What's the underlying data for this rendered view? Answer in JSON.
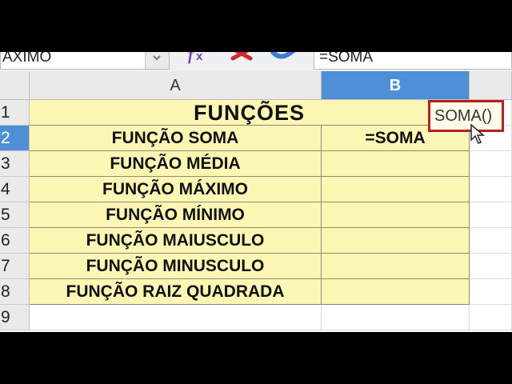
{
  "toolbar": {
    "name_box_value": "AXIMO",
    "formula_value": "=SOMA",
    "icons": [
      "function-wizard-icon",
      "cancel-icon",
      "accept-icon"
    ]
  },
  "columns": [
    "A",
    "B"
  ],
  "rows": [
    {
      "num": "1",
      "a": "FUNÇÕES",
      "b": ""
    },
    {
      "num": "2",
      "a": "FUNÇÃO SOMA",
      "b": "=SOMA"
    },
    {
      "num": "3",
      "a": "FUNÇÃO MÉDIA",
      "b": ""
    },
    {
      "num": "4",
      "a": "FUNÇÃO MÁXIMO",
      "b": ""
    },
    {
      "num": "5",
      "a": "FUNÇÃO MÍNIMO",
      "b": ""
    },
    {
      "num": "6",
      "a": "FUNÇÃO MAIUSCULO",
      "b": ""
    },
    {
      "num": "7",
      "a": "FUNÇÃO MINUSCULO",
      "b": ""
    },
    {
      "num": "8",
      "a": "FUNÇÃO RAIZ QUADRADA",
      "b": ""
    },
    {
      "num": "9",
      "a": "",
      "b": ""
    }
  ],
  "autocomplete_tooltip": "SOMA()",
  "colors": {
    "cell_fill": "#fdf7b5",
    "selection_header": "#4f8fd6",
    "tooltip_border": "#b51f1f"
  }
}
